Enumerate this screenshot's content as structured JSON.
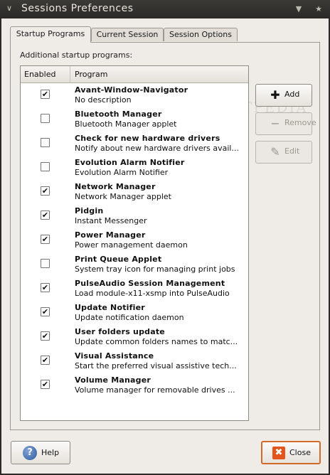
{
  "window": {
    "title": "Sessions Preferences",
    "menu_icon": "chevron-down-icon",
    "controls": [
      "minimize-icon",
      "close-icon"
    ]
  },
  "tabs": [
    {
      "label": "Startup Programs",
      "active": true
    },
    {
      "label": "Current Session",
      "active": false
    },
    {
      "label": "Session Options",
      "active": false
    }
  ],
  "startup": {
    "section_label": "Additional startup programs:",
    "columns": {
      "enabled": "Enabled",
      "program": "Program"
    },
    "programs": [
      {
        "name": "Avant-Window-Navigator",
        "description": "No description",
        "enabled": true
      },
      {
        "name": "Bluetooth Manager",
        "description": "Bluetooth Manager applet",
        "enabled": false
      },
      {
        "name": "Check for new hardware drivers",
        "description": "Notify about new hardware drivers avail...",
        "enabled": false
      },
      {
        "name": "Evolution Alarm Notifier",
        "description": "Evolution Alarm Notifier",
        "enabled": false
      },
      {
        "name": "Network Manager",
        "description": "Network Manager applet",
        "enabled": true
      },
      {
        "name": "Pidgin",
        "description": "Instant Messenger",
        "enabled": true
      },
      {
        "name": "Power Manager",
        "description": "Power management daemon",
        "enabled": true
      },
      {
        "name": "Print Queue Applet",
        "description": "System tray icon for managing print jobs",
        "enabled": false
      },
      {
        "name": "PulseAudio Session Management",
        "description": "Load module-x11-xsmp into PulseAudio",
        "enabled": true
      },
      {
        "name": "Update Notifier",
        "description": "Update notification daemon",
        "enabled": true
      },
      {
        "name": "User folders update",
        "description": "Update common folders names to matc...",
        "enabled": true
      },
      {
        "name": "Visual Assistance",
        "description": "Start the preferred visual assistive tech...",
        "enabled": true
      },
      {
        "name": "Volume Manager",
        "description": "Volume manager for removable drives ...",
        "enabled": true
      }
    ],
    "buttons": {
      "add": {
        "label": "Add",
        "icon": "plus-icon",
        "enabled": true
      },
      "remove": {
        "label": "Remove",
        "icon": "minus-icon",
        "enabled": false
      },
      "edit": {
        "label": "Edit",
        "icon": "edit-icon",
        "enabled": false
      }
    }
  },
  "footer": {
    "help_label": "Help",
    "help_icon": "help-icon",
    "close_label": "Close",
    "close_icon": "close-x-icon"
  },
  "watermark": "SOFTPEDIA",
  "colors": {
    "close_accent": "#e2561c",
    "titlebar": "#2c2b29"
  }
}
